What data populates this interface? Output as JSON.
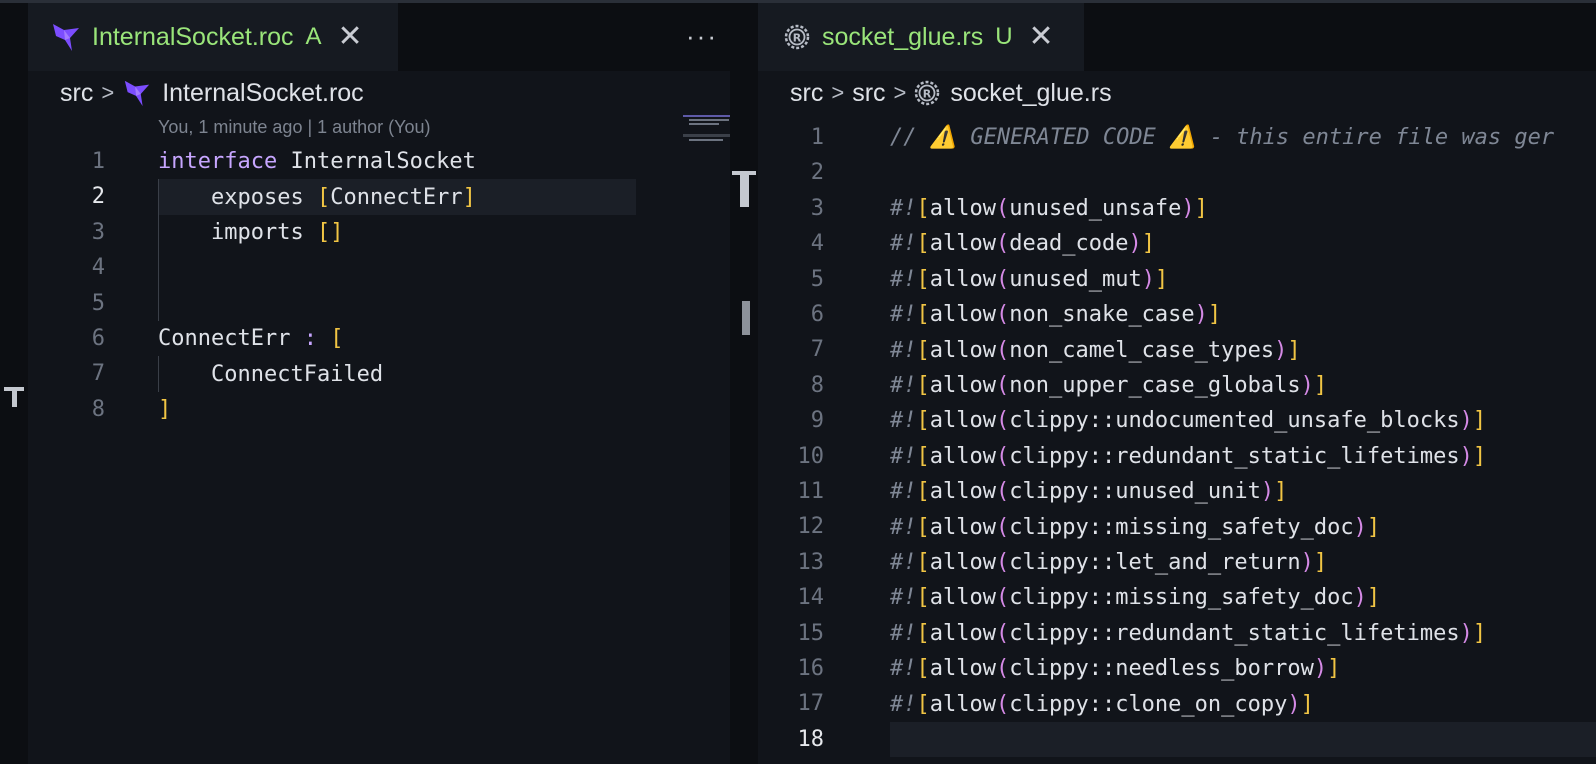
{
  "left_editor": {
    "tab": {
      "label": "InternalSocket.roc",
      "status": "A",
      "close": "✕"
    },
    "more_actions": "···",
    "breadcrumb": {
      "folder": "src",
      "file": "InternalSocket.roc"
    },
    "blame": "You, 1 minute ago | 1 author (You)",
    "lines": [
      {
        "n": "1",
        "tokens": [
          [
            "kw",
            "interface"
          ],
          [
            "tx",
            " InternalSocket"
          ]
        ]
      },
      {
        "n": "2",
        "tokens": [
          [
            "tx",
            "    exposes "
          ],
          [
            "br",
            "["
          ],
          [
            "tx",
            "ConnectErr"
          ],
          [
            "br",
            "]"
          ]
        ]
      },
      {
        "n": "3",
        "tokens": [
          [
            "tx",
            "    imports "
          ],
          [
            "br",
            "[]"
          ]
        ]
      },
      {
        "n": "4",
        "tokens": []
      },
      {
        "n": "5",
        "tokens": []
      },
      {
        "n": "6",
        "tokens": [
          [
            "tx",
            "ConnectErr "
          ],
          [
            "op",
            ":"
          ],
          [
            "tx",
            " "
          ],
          [
            "br",
            "["
          ]
        ]
      },
      {
        "n": "7",
        "tokens": [
          [
            "tx",
            "    ConnectFailed"
          ]
        ]
      },
      {
        "n": "8",
        "tokens": [
          [
            "br",
            "]"
          ]
        ]
      }
    ],
    "active_line": "2"
  },
  "right_editor": {
    "tab": {
      "label": "socket_glue.rs",
      "status": "U",
      "close": "✕"
    },
    "breadcrumb": {
      "folder1": "src",
      "folder2": "src",
      "file": "socket_glue.rs"
    },
    "lines": [
      {
        "n": "1",
        "tokens": [
          [
            "cm",
            "// ⚠️ GENERATED CODE ⚠️ - this entire file was ger"
          ]
        ]
      },
      {
        "n": "2",
        "tokens": []
      },
      {
        "n": "3",
        "tokens": [
          [
            "cm",
            "#!"
          ],
          [
            "br",
            "["
          ],
          [
            "tx",
            "allow"
          ],
          [
            "pa",
            "("
          ],
          [
            "tx",
            "unused_unsafe"
          ],
          [
            "pa",
            ")"
          ],
          [
            "br",
            "]"
          ]
        ]
      },
      {
        "n": "4",
        "tokens": [
          [
            "cm",
            "#!"
          ],
          [
            "br",
            "["
          ],
          [
            "tx",
            "allow"
          ],
          [
            "pa",
            "("
          ],
          [
            "tx",
            "dead_code"
          ],
          [
            "pa",
            ")"
          ],
          [
            "br",
            "]"
          ]
        ]
      },
      {
        "n": "5",
        "tokens": [
          [
            "cm",
            "#!"
          ],
          [
            "br",
            "["
          ],
          [
            "tx",
            "allow"
          ],
          [
            "pa",
            "("
          ],
          [
            "tx",
            "unused_mut"
          ],
          [
            "pa",
            ")"
          ],
          [
            "br",
            "]"
          ]
        ]
      },
      {
        "n": "6",
        "tokens": [
          [
            "cm",
            "#!"
          ],
          [
            "br",
            "["
          ],
          [
            "tx",
            "allow"
          ],
          [
            "pa",
            "("
          ],
          [
            "tx",
            "non_snake_case"
          ],
          [
            "pa",
            ")"
          ],
          [
            "br",
            "]"
          ]
        ]
      },
      {
        "n": "7",
        "tokens": [
          [
            "cm",
            "#!"
          ],
          [
            "br",
            "["
          ],
          [
            "tx",
            "allow"
          ],
          [
            "pa",
            "("
          ],
          [
            "tx",
            "non_camel_case_types"
          ],
          [
            "pa",
            ")"
          ],
          [
            "br",
            "]"
          ]
        ]
      },
      {
        "n": "8",
        "tokens": [
          [
            "cm",
            "#!"
          ],
          [
            "br",
            "["
          ],
          [
            "tx",
            "allow"
          ],
          [
            "pa",
            "("
          ],
          [
            "tx",
            "non_upper_case_globals"
          ],
          [
            "pa",
            ")"
          ],
          [
            "br",
            "]"
          ]
        ]
      },
      {
        "n": "9",
        "tokens": [
          [
            "cm",
            "#!"
          ],
          [
            "br",
            "["
          ],
          [
            "tx",
            "allow"
          ],
          [
            "pa",
            "("
          ],
          [
            "tx",
            "clippy::undocumented_unsafe_blocks"
          ],
          [
            "pa",
            ")"
          ],
          [
            "br",
            "]"
          ]
        ]
      },
      {
        "n": "10",
        "tokens": [
          [
            "cm",
            "#!"
          ],
          [
            "br",
            "["
          ],
          [
            "tx",
            "allow"
          ],
          [
            "pa",
            "("
          ],
          [
            "tx",
            "clippy::redundant_static_lifetimes"
          ],
          [
            "pa",
            ")"
          ],
          [
            "br",
            "]"
          ]
        ]
      },
      {
        "n": "11",
        "tokens": [
          [
            "cm",
            "#!"
          ],
          [
            "br",
            "["
          ],
          [
            "tx",
            "allow"
          ],
          [
            "pa",
            "("
          ],
          [
            "tx",
            "clippy::unused_unit"
          ],
          [
            "pa",
            ")"
          ],
          [
            "br",
            "]"
          ]
        ]
      },
      {
        "n": "12",
        "tokens": [
          [
            "cm",
            "#!"
          ],
          [
            "br",
            "["
          ],
          [
            "tx",
            "allow"
          ],
          [
            "pa",
            "("
          ],
          [
            "tx",
            "clippy::missing_safety_doc"
          ],
          [
            "pa",
            ")"
          ],
          [
            "br",
            "]"
          ]
        ]
      },
      {
        "n": "13",
        "tokens": [
          [
            "cm",
            "#!"
          ],
          [
            "br",
            "["
          ],
          [
            "tx",
            "allow"
          ],
          [
            "pa",
            "("
          ],
          [
            "tx",
            "clippy::let_and_return"
          ],
          [
            "pa",
            ")"
          ],
          [
            "br",
            "]"
          ]
        ]
      },
      {
        "n": "14",
        "tokens": [
          [
            "cm",
            "#!"
          ],
          [
            "br",
            "["
          ],
          [
            "tx",
            "allow"
          ],
          [
            "pa",
            "("
          ],
          [
            "tx",
            "clippy::missing_safety_doc"
          ],
          [
            "pa",
            ")"
          ],
          [
            "br",
            "]"
          ]
        ]
      },
      {
        "n": "15",
        "tokens": [
          [
            "cm",
            "#!"
          ],
          [
            "br",
            "["
          ],
          [
            "tx",
            "allow"
          ],
          [
            "pa",
            "("
          ],
          [
            "tx",
            "clippy::redundant_static_lifetimes"
          ],
          [
            "pa",
            ")"
          ],
          [
            "br",
            "]"
          ]
        ]
      },
      {
        "n": "16",
        "tokens": [
          [
            "cm",
            "#!"
          ],
          [
            "br",
            "["
          ],
          [
            "tx",
            "allow"
          ],
          [
            "pa",
            "("
          ],
          [
            "tx",
            "clippy::needless_borrow"
          ],
          [
            "pa",
            ")"
          ],
          [
            "br",
            "]"
          ]
        ]
      },
      {
        "n": "17",
        "tokens": [
          [
            "cm",
            "#!"
          ],
          [
            "br",
            "["
          ],
          [
            "tx",
            "allow"
          ],
          [
            "pa",
            "("
          ],
          [
            "tx",
            "clippy::clone_on_copy"
          ],
          [
            "pa",
            ")"
          ],
          [
            "br",
            "]"
          ]
        ]
      },
      {
        "n": "18",
        "tokens": []
      }
    ],
    "active_line": "18"
  },
  "colors": {
    "accent_green": "#9ae57a",
    "keyword": "#c7a6ff",
    "bracket": "#f1c544",
    "paren": "#d58ae6",
    "comment": "#7f8795"
  },
  "icons": {
    "roc_logo": "roc-bird-icon",
    "rust_logo": "rust-gear-icon"
  }
}
